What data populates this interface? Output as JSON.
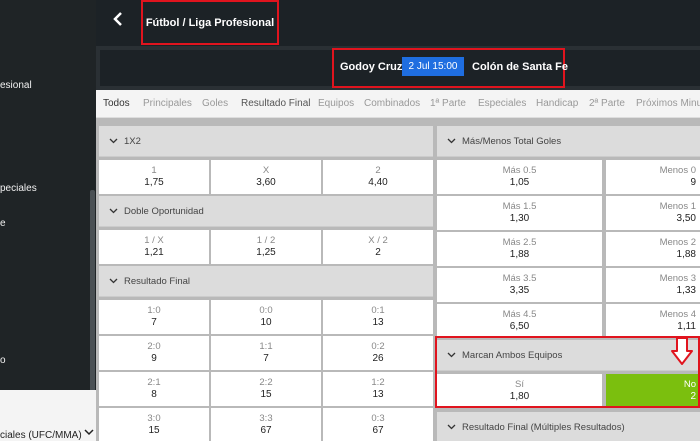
{
  "sidebar": {
    "items": [
      "esional",
      "peciales",
      "e",
      "o"
    ],
    "bottom_item": "ciales (UFC/MMA)"
  },
  "header": {
    "back_label": "‹",
    "title": "Fútbol / Liga Profesional"
  },
  "match": {
    "home": "Godoy Cruz",
    "kickoff": "2 Jul 15:00",
    "away": "Colón de Santa Fe"
  },
  "tabs": [
    "Todos",
    "Principales",
    "Goles",
    "Resultado Final",
    "Equipos",
    "Combinados",
    "1ª Parte",
    "Especiales",
    "Handicap",
    "2ª Parte",
    "Próximos Minut"
  ],
  "left": {
    "x12": {
      "title": "1X2",
      "cells": [
        {
          "label": "1",
          "odds": "1,75"
        },
        {
          "label": "X",
          "odds": "3,60"
        },
        {
          "label": "2",
          "odds": "4,40"
        }
      ]
    },
    "doble": {
      "title": "Doble Oportunidad",
      "cells": [
        {
          "label": "1 / X",
          "odds": "1,21"
        },
        {
          "label": "1 / 2",
          "odds": "1,25"
        },
        {
          "label": "X / 2",
          "odds": "2"
        }
      ]
    },
    "resultado": {
      "title": "Resultado Final",
      "rows": [
        [
          {
            "label": "1:0",
            "odds": "7"
          },
          {
            "label": "0:0",
            "odds": "10"
          },
          {
            "label": "0:1",
            "odds": "13"
          }
        ],
        [
          {
            "label": "2:0",
            "odds": "9"
          },
          {
            "label": "1:1",
            "odds": "7"
          },
          {
            "label": "0:2",
            "odds": "26"
          }
        ],
        [
          {
            "label": "2:1",
            "odds": "8"
          },
          {
            "label": "2:2",
            "odds": "15"
          },
          {
            "label": "1:2",
            "odds": "13"
          }
        ],
        [
          {
            "label": "3:0",
            "odds": "15"
          },
          {
            "label": "3:3",
            "odds": "67"
          },
          {
            "label": "0:3",
            "odds": "67"
          }
        ]
      ]
    }
  },
  "right": {
    "goles": {
      "title": "Más/Menos Total Goles",
      "rows": [
        [
          {
            "label": "Más 0.5",
            "odds": "1,05"
          },
          {
            "label": "Menos 0",
            "odds": "9"
          }
        ],
        [
          {
            "label": "Más 1.5",
            "odds": "1,30"
          },
          {
            "label": "Menos 1",
            "odds": "3,50"
          }
        ],
        [
          {
            "label": "Más 2.5",
            "odds": "1,88"
          },
          {
            "label": "Menos 2",
            "odds": "1,88"
          }
        ],
        [
          {
            "label": "Más 3.5",
            "odds": "3,35"
          },
          {
            "label": "Menos 3",
            "odds": "1,33"
          }
        ],
        [
          {
            "label": "Más 4.5",
            "odds": "6,50"
          },
          {
            "label": "Menos 4",
            "odds": "1,11"
          }
        ]
      ]
    },
    "ambos": {
      "title": "Marcan Ambos Equipos",
      "cells": [
        {
          "label": "Sí",
          "odds": "1,80"
        },
        {
          "label": "No",
          "odds": "2"
        }
      ]
    },
    "multiples": {
      "title": "Resultado Final (Múltiples Resultados)"
    }
  },
  "colors": {
    "highlight": "#e0141e",
    "selected": "#7bbf0e",
    "kickoff_bg": "#1f6ee0"
  }
}
